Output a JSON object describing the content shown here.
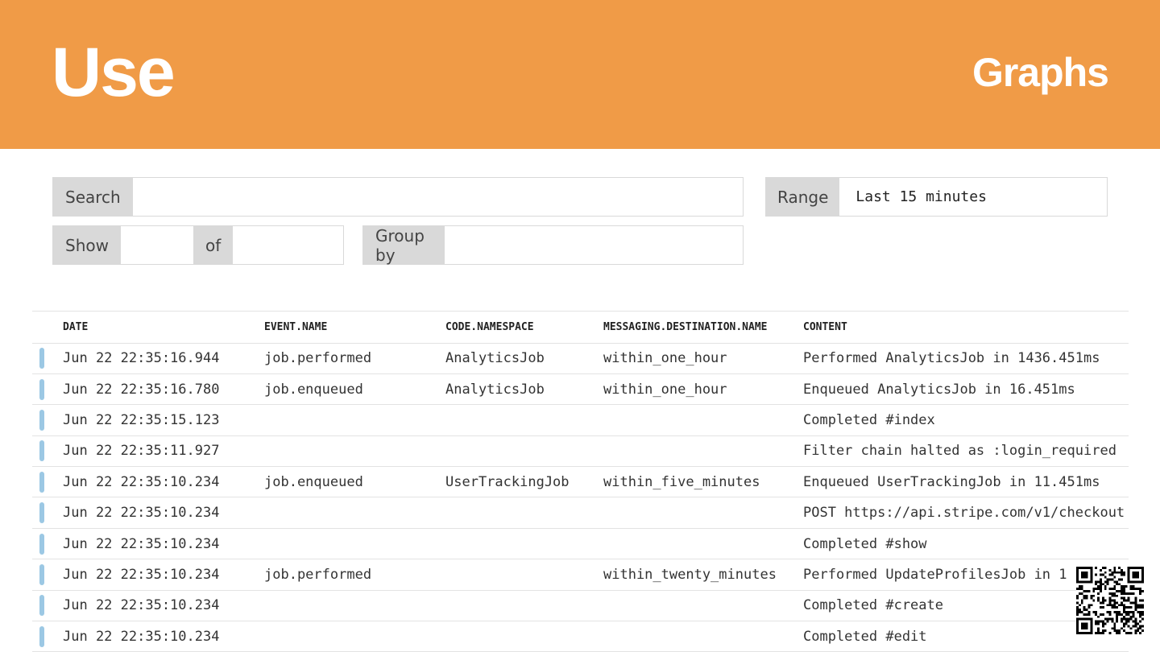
{
  "header": {
    "title": "Use",
    "subtitle": "Graphs",
    "background": "#f09b47"
  },
  "filters": {
    "search": {
      "label": "Search",
      "value": ""
    },
    "range": {
      "label": "Range",
      "value": "Last 15 minutes"
    },
    "show": {
      "label": "Show",
      "value": "",
      "of_label": "of",
      "of_value": ""
    },
    "group_by": {
      "label": "Group by",
      "value": ""
    }
  },
  "table": {
    "columns": [
      "DATE",
      "EVENT.NAME",
      "CODE.NAMESPACE",
      "MESSAGING.DESTINATION.NAME",
      "CONTENT"
    ],
    "indicator_color": "#9cc8e4",
    "rows": [
      {
        "date": "Jun 22 22:35:16.944",
        "event": "job.performed",
        "namespace": "AnalyticsJob",
        "destination": "within_one_hour",
        "content": "Performed AnalyticsJob in 1436.451ms"
      },
      {
        "date": "Jun 22 22:35:16.780",
        "event": "job.enqueued",
        "namespace": "AnalyticsJob",
        "destination": "within_one_hour",
        "content": "Enqueued AnalyticsJob in 16.451ms"
      },
      {
        "date": "Jun 22 22:35:15.123",
        "event": "",
        "namespace": "",
        "destination": "",
        "content": "Completed #index"
      },
      {
        "date": "Jun 22 22:35:11.927",
        "event": "",
        "namespace": "",
        "destination": "",
        "content": "Filter chain halted as :login_required"
      },
      {
        "date": "Jun 22 22:35:10.234",
        "event": "job.enqueued",
        "namespace": "UserTrackingJob",
        "destination": "within_five_minutes",
        "content": "Enqueued UserTrackingJob in 11.451ms"
      },
      {
        "date": "Jun 22 22:35:10.234",
        "event": "",
        "namespace": "",
        "destination": "",
        "content": "POST https://api.stripe.com/v1/checkout"
      },
      {
        "date": "Jun 22 22:35:10.234",
        "event": "",
        "namespace": "",
        "destination": "",
        "content": "Completed #show"
      },
      {
        "date": "Jun 22 22:35:10.234",
        "event": "job.performed",
        "namespace": "",
        "destination": "within_twenty_minutes",
        "content": "Performed UpdateProfilesJob in 1"
      },
      {
        "date": "Jun 22 22:35:10.234",
        "event": "",
        "namespace": "",
        "destination": "",
        "content": "Completed #create"
      },
      {
        "date": "Jun 22 22:35:10.234",
        "event": "",
        "namespace": "",
        "destination": "",
        "content": "Completed #edit"
      }
    ]
  },
  "qr_code": {
    "icon": "qr-code-icon"
  }
}
